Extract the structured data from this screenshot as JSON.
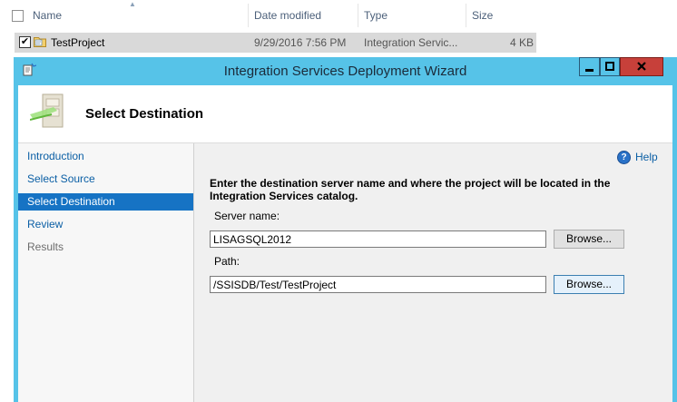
{
  "explorer": {
    "columns": {
      "name": "Name",
      "date_modified": "Date modified",
      "type": "Type",
      "size": "Size"
    },
    "rows": [
      {
        "name": "TestProject",
        "date_modified": "9/29/2016 7:56 PM",
        "type": "Integration Servic...",
        "size": "4 KB",
        "checked": true
      }
    ]
  },
  "wizard": {
    "title": "Integration Services Deployment Wizard",
    "banner_title": "Select Destination",
    "nav": [
      {
        "label": "Introduction",
        "state": "link"
      },
      {
        "label": "Select Source",
        "state": "link"
      },
      {
        "label": "Select Destination",
        "state": "selected"
      },
      {
        "label": "Review",
        "state": "link"
      },
      {
        "label": "Results",
        "state": "disabled"
      }
    ],
    "help_label": "Help",
    "instruction": "Enter the destination server name and where the project will be located in the Integration Services catalog.",
    "server_label": "Server name:",
    "server_value": "LISAGSQL2012",
    "path_label": "Path:",
    "path_value": "/SSISDB/Test/TestProject",
    "browse_label": "Browse..."
  },
  "colors": {
    "titlebar": "#56c3e8",
    "selected_nav": "#1673c4",
    "link": "#0b5fa5",
    "close_button": "#c7403a"
  }
}
